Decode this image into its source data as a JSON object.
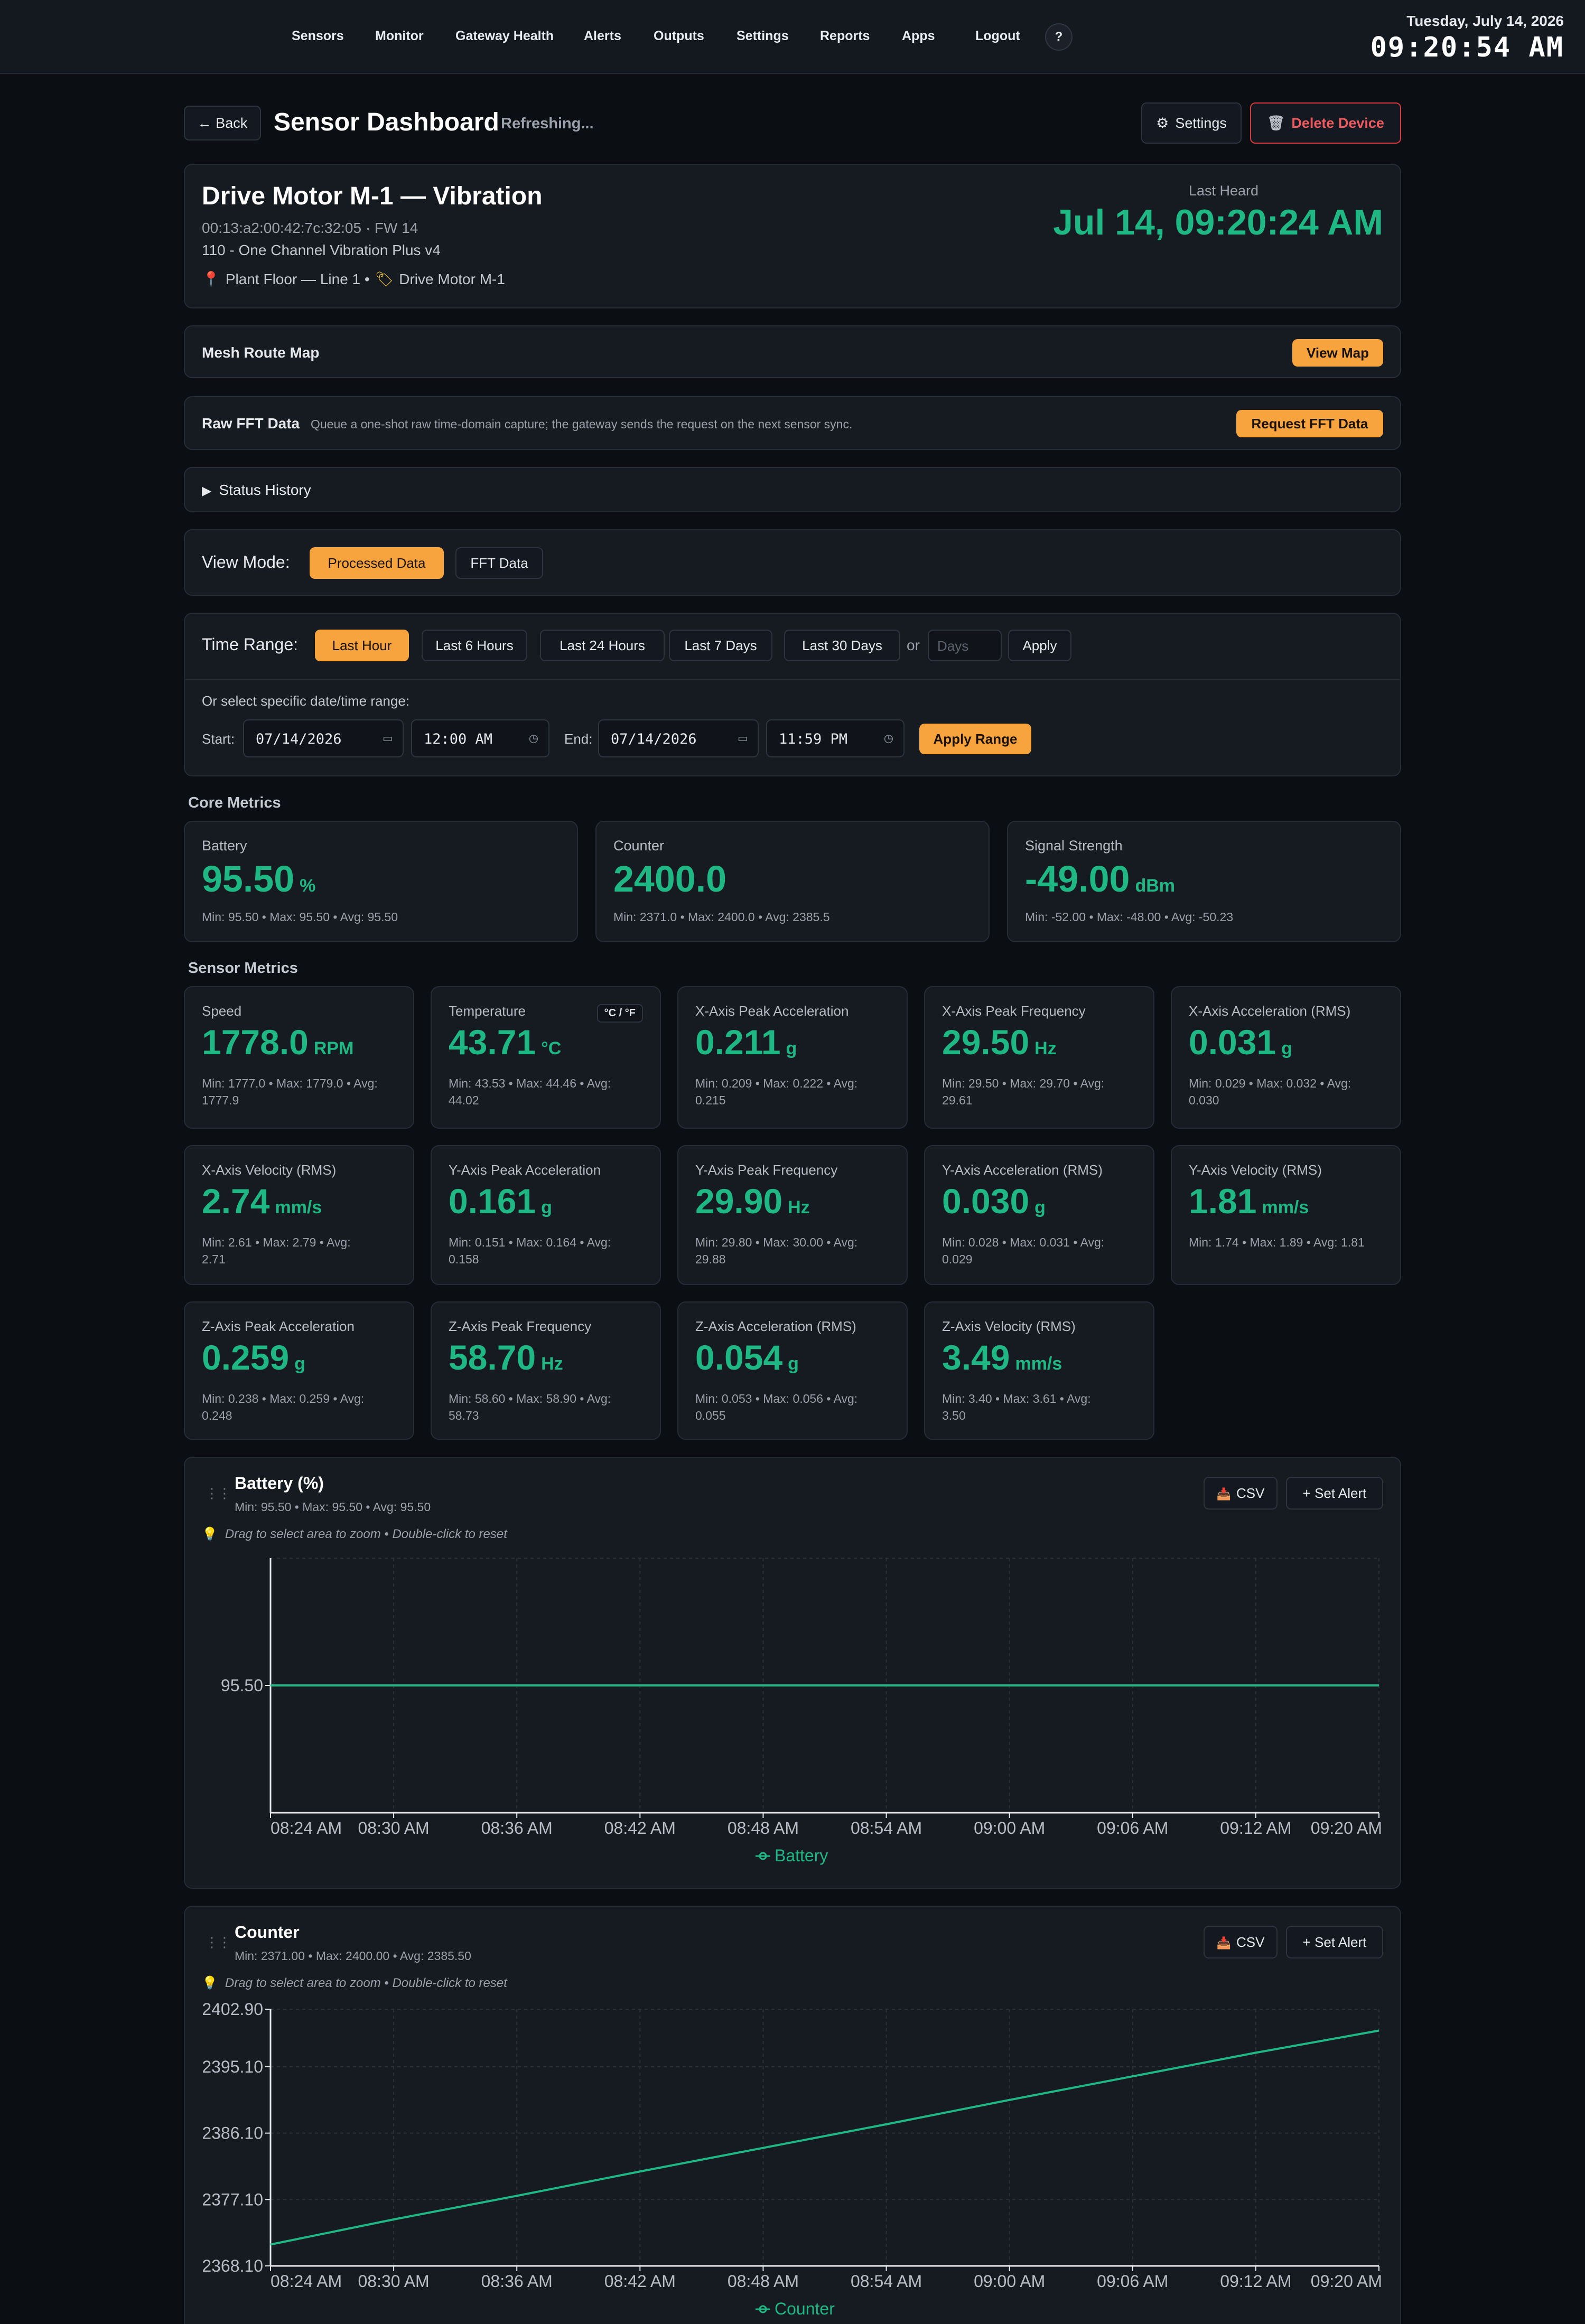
{
  "nav": {
    "items": [
      "Sensors",
      "Monitor",
      "Gateway Health",
      "Alerts",
      "Outputs",
      "Settings",
      "Reports",
      "Apps",
      "Logout"
    ],
    "help": "?"
  },
  "clock": {
    "date": "Tuesday, July 14, 2026",
    "time": "09:20:54 AM"
  },
  "header": {
    "back": "← Back",
    "title": "Sensor Dashboard",
    "status": "Refreshing...",
    "settings": "Settings",
    "delete": "Delete Device"
  },
  "device": {
    "name": "Drive Motor M-1 — Vibration",
    "mac": "00:13:a2:00:42:7c:32:05 · FW 14",
    "model": "110 - One Channel Vibration Plus v4",
    "location": "Plant Floor — Line 1 •",
    "tag": "Drive Motor M-1",
    "last_heard_label": "Last Heard",
    "last_heard": "Jul 14, 09:20:24 AM"
  },
  "mesh": {
    "title": "Mesh Route Map",
    "button": "View Map"
  },
  "fft": {
    "title": "Raw FFT Data",
    "desc": "Queue a one-shot raw time-domain capture; the gateway sends the request on the next sensor sync.",
    "button": "Request FFT Data"
  },
  "status_history": {
    "label": "Status History"
  },
  "view_mode": {
    "label": "View Mode:",
    "options": [
      "Processed Data",
      "FFT Data"
    ],
    "selected": "Processed Data"
  },
  "time_range": {
    "label": "Time Range:",
    "options": [
      "Last Hour",
      "Last 6 Hours",
      "Last 24 Hours",
      "Last 7 Days",
      "Last 30 Days"
    ],
    "selected": "Last Hour",
    "or": "or",
    "days_placeholder": "Days",
    "apply": "Apply",
    "specific_label": "Or select specific date/time range:",
    "start_label": "Start:",
    "start_date": "07/14/2026",
    "start_time": "12:00 AM",
    "end_label": "End:",
    "end_date": "07/14/2026",
    "end_time": "11:59 PM",
    "apply_range": "Apply Range"
  },
  "core_metrics": {
    "title": "Core Metrics",
    "items": [
      {
        "label": "Battery",
        "value": "95.50",
        "unit": "%",
        "stats": "Min: 95.50 • Max: 95.50 • Avg: 95.50"
      },
      {
        "label": "Counter",
        "value": "2400.0",
        "unit": "",
        "stats": "Min: 2371.0 • Max: 2400.0 • Avg: 2385.5"
      },
      {
        "label": "Signal Strength",
        "value": "-49.00",
        "unit": "dBm",
        "stats": "Min: -52.00 • Max: -48.00 • Avg: -50.23"
      }
    ]
  },
  "sensor_metrics": {
    "title": "Sensor Metrics",
    "unit_toggle": "°C / °F",
    "items": [
      {
        "label": "Speed",
        "value": "1778.0",
        "unit": "RPM",
        "stats1": "Min: 1777.0 • Max: 1779.0 • Avg:",
        "stats2": "1777.9"
      },
      {
        "label": "Temperature",
        "value": "43.71",
        "unit": "°C",
        "stats1": "Min: 43.53 • Max: 44.46 • Avg:",
        "stats2": "44.02"
      },
      {
        "label": "X-Axis Peak Acceleration",
        "value": "0.211",
        "unit": "g",
        "stats1": "Min: 0.209 • Max: 0.222 • Avg:",
        "stats2": "0.215"
      },
      {
        "label": "X-Axis Peak Frequency",
        "value": "29.50",
        "unit": "Hz",
        "stats1": "Min: 29.50 • Max: 29.70 • Avg:",
        "stats2": "29.61"
      },
      {
        "label": "X-Axis Acceleration (RMS)",
        "value": "0.031",
        "unit": "g",
        "stats1": "Min: 0.029 • Max: 0.032 • Avg:",
        "stats2": "0.030"
      },
      {
        "label": "X-Axis Velocity (RMS)",
        "value": "2.74",
        "unit": "mm/s",
        "stats1": "Min: 2.61 • Max: 2.79 • Avg:",
        "stats2": "2.71"
      },
      {
        "label": "Y-Axis Peak Acceleration",
        "value": "0.161",
        "unit": "g",
        "stats1": "Min: 0.151 • Max: 0.164 • Avg:",
        "stats2": "0.158"
      },
      {
        "label": "Y-Axis Peak Frequency",
        "value": "29.90",
        "unit": "Hz",
        "stats1": "Min: 29.80 • Max: 30.00 • Avg:",
        "stats2": "29.88"
      },
      {
        "label": "Y-Axis Acceleration (RMS)",
        "value": "0.030",
        "unit": "g",
        "stats1": "Min: 0.028 • Max: 0.031 • Avg:",
        "stats2": "0.029"
      },
      {
        "label": "Y-Axis Velocity (RMS)",
        "value": "1.81",
        "unit": "mm/s",
        "stats1": "Min: 1.74 • Max: 1.89 • Avg: 1.81",
        "stats2": ""
      },
      {
        "label": "Z-Axis Peak Acceleration",
        "value": "0.259",
        "unit": "g",
        "stats1": "Min: 0.238 • Max: 0.259 • Avg:",
        "stats2": "0.248"
      },
      {
        "label": "Z-Axis Peak Frequency",
        "value": "58.70",
        "unit": "Hz",
        "stats1": "Min: 58.60 • Max: 58.90 • Avg:",
        "stats2": "58.73"
      },
      {
        "label": "Z-Axis Acceleration (RMS)",
        "value": "0.054",
        "unit": "g",
        "stats1": "Min: 0.053 • Max: 0.056 • Avg:",
        "stats2": "0.055"
      },
      {
        "label": "Z-Axis Velocity (RMS)",
        "value": "3.49",
        "unit": "mm/s",
        "stats1": "Min: 3.40 • Max: 3.61 • Avg:",
        "stats2": "3.50"
      }
    ]
  },
  "chart_hint": "Drag to select area to zoom • Double-click to reset",
  "chart_buttons": {
    "csv": "CSV",
    "alert": "+ Set Alert"
  },
  "chart_data": [
    {
      "type": "line",
      "title": "Battery (%)",
      "stats": "Min: 95.50 • Max: 95.50 • Avg: 95.50",
      "x": [
        "08:24 AM",
        "08:30 AM",
        "08:36 AM",
        "08:42 AM",
        "08:48 AM",
        "08:54 AM",
        "09:00 AM",
        "09:06 AM",
        "09:12 AM",
        "09:20 AM"
      ],
      "yticks": [
        "95.50"
      ],
      "series": [
        {
          "name": "Battery",
          "values": [
            95.5,
            95.5,
            95.5,
            95.5,
            95.5,
            95.5,
            95.5,
            95.5,
            95.5,
            95.5
          ]
        }
      ],
      "ylim": [
        94.5,
        96.5
      ],
      "grid": true,
      "legend": "bottom",
      "color": "#1fb884"
    },
    {
      "type": "line",
      "title": "Counter",
      "stats": "Min: 2371.00 • Max: 2400.00 • Avg: 2385.50",
      "x": [
        "08:24 AM",
        "08:30 AM",
        "08:36 AM",
        "08:42 AM",
        "08:48 AM",
        "08:54 AM",
        "09:00 AM",
        "09:06 AM",
        "09:12 AM",
        "09:20 AM"
      ],
      "yticks": [
        "2402.90",
        "2395.10",
        "2386.10",
        "2377.10",
        "2368.10"
      ],
      "series": [
        {
          "name": "Counter",
          "values": [
            2371.0,
            2374.4,
            2377.6,
            2380.9,
            2384.1,
            2387.3,
            2390.6,
            2393.8,
            2397.0,
            2400.0
          ]
        }
      ],
      "ylim": [
        2368.1,
        2402.9
      ],
      "grid": true,
      "legend": "bottom",
      "color": "#1fb884"
    }
  ]
}
